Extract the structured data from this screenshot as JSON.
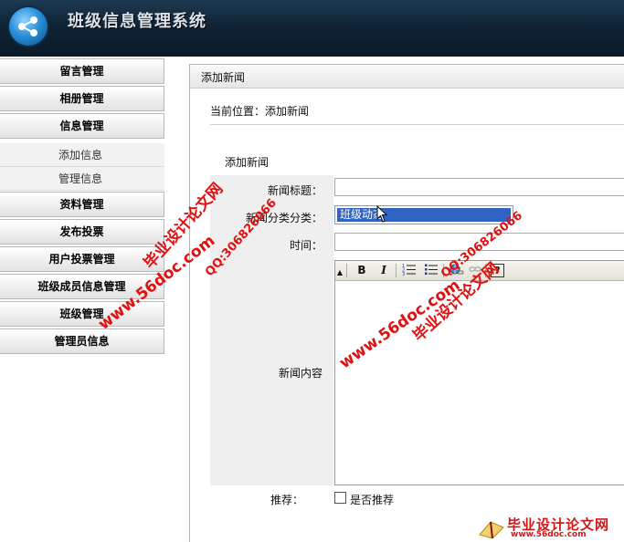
{
  "app": {
    "title": "班级信息管理系统"
  },
  "sidebar": {
    "items": [
      {
        "label": "留言管理"
      },
      {
        "label": "相册管理"
      },
      {
        "label": "信息管理"
      },
      {
        "label": "资料管理"
      },
      {
        "label": "发布投票"
      },
      {
        "label": "用户投票管理"
      },
      {
        "label": "班级成员信息管理"
      },
      {
        "label": "班级管理"
      },
      {
        "label": "管理员信息"
      }
    ],
    "subitems": [
      {
        "label": "添加信息"
      },
      {
        "label": "管理信息"
      }
    ]
  },
  "main": {
    "tab_title": "添加新闻",
    "breadcrumb": "当前位置：添加新闻",
    "form_heading": "添加新闻",
    "fields": {
      "title_label": "新闻标题：",
      "title_value": "",
      "category_label": "新闻分类分类：",
      "category_value": "班级动态",
      "time_label": "时间：",
      "time_value": "",
      "content_label": "新闻内容",
      "recommend_label": "推荐：",
      "recommend_checkbox_label": "是否推荐"
    },
    "editor_toolbar": {
      "bold": "B",
      "italic": "I",
      "help": "?"
    }
  },
  "watermarks": {
    "site_name": "毕业设计论文网",
    "qq": "QQ:306826066",
    "url": "www.56doc.com",
    "logo_url": "www.56doc.com"
  },
  "colors": {
    "header": "#0f2335",
    "selected_option": "#3163c5",
    "watermark": "#e01010"
  }
}
